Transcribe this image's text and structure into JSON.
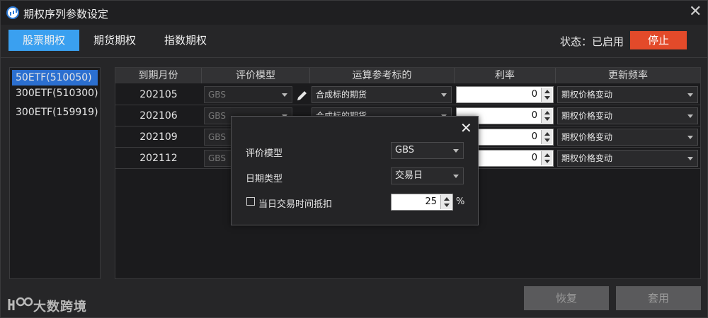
{
  "window": {
    "title": "期权序列参数设定"
  },
  "tabs": [
    {
      "label": "股票期权",
      "active": true
    },
    {
      "label": "期货期权",
      "active": false
    },
    {
      "label": "指数期权",
      "active": false
    }
  ],
  "status": {
    "text": "状态：已启用",
    "stop_label": "停止"
  },
  "underlyings": [
    {
      "label": "50ETF(510050)",
      "selected": true
    },
    {
      "label": "300ETF(510300)",
      "selected": false
    },
    {
      "label": "300ETF(159919)",
      "selected": false
    }
  ],
  "table": {
    "headers": [
      "到期月份",
      "评价模型",
      "运算参考标的",
      "利率",
      "更新频率"
    ],
    "rows": [
      {
        "month": "202105",
        "model": "GBS",
        "reference": "合成标的期货",
        "rate": "0",
        "frequency": "期权价格变动"
      },
      {
        "month": "202106",
        "model": "GBS",
        "reference": "合成标的期货",
        "rate": "0",
        "frequency": "期权价格变动"
      },
      {
        "month": "202109",
        "model": "GBS",
        "reference": "",
        "rate": "0",
        "frequency": "期权价格变动"
      },
      {
        "month": "202112",
        "model": "GBS",
        "reference": "",
        "rate": "0",
        "frequency": "期权价格变动"
      }
    ]
  },
  "dialog": {
    "model_label": "评价模型",
    "model_value": "GBS",
    "date_type_label": "日期类型",
    "date_type_value": "交易日",
    "intraday_label": "当日交易时间抵扣",
    "intraday_value": "25",
    "percent": "%"
  },
  "footer": {
    "logo_text": "大数跨境",
    "restore_label": "恢复",
    "apply_label": "套用"
  },
  "colors": {
    "accent": "#3aa0f0",
    "stop": "#e34a2a",
    "selected": "#2b6fd0"
  }
}
